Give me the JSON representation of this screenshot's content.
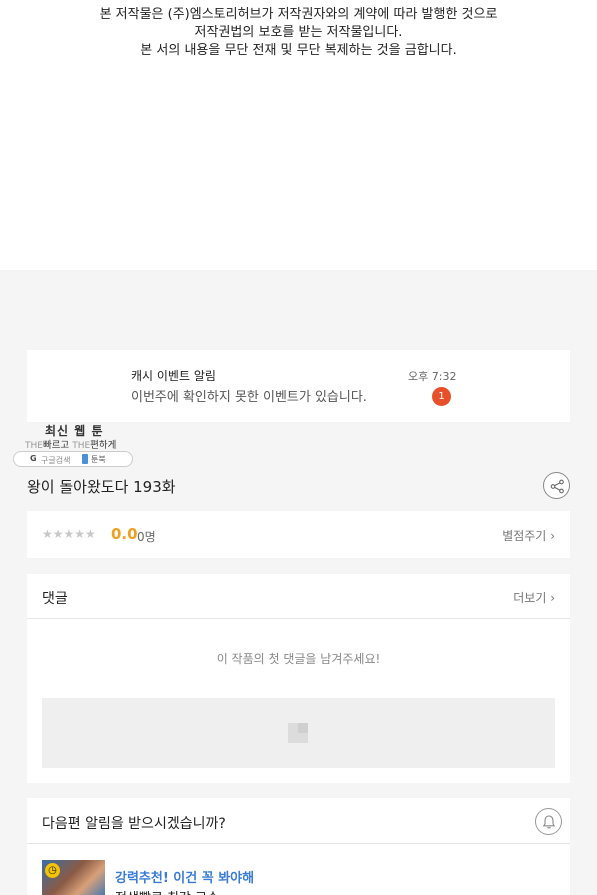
{
  "copyright": {
    "line1": "본 저작물은 (주)엠스토리허브가 저작권자와의 계약에 따라 발행한 것으로",
    "line2": "저작권법의 보호를 받는 저작물입니다.",
    "line3": "본 서의 내용을 무단 전재 및 무단 복제하는 것을 금합니다."
  },
  "notification": {
    "title": "캐시 이벤트 알림",
    "message": "이번주에 확인하지 못한 이벤트가 있습니다.",
    "time": "오후 7:32",
    "badge": "1",
    "badge_color": "#e8502b"
  },
  "logo": {
    "name": "최신 웹 툰",
    "tag_the1": "THE",
    "tag_fast": "빠르고",
    "tag_the2": "THE",
    "tag_easy": "편하게",
    "search_label": "구글검색",
    "bookmark_label": "툰북"
  },
  "episode": {
    "title": "왕이 돌아왔도다 193화",
    "share_icon": "share-icon"
  },
  "rating": {
    "stars": "★★★★★",
    "score": "0.0",
    "count": "0명",
    "rate_label": "별점주기",
    "score_color": "#f0a020"
  },
  "comments": {
    "title": "댓글",
    "more_label": "더보기",
    "empty_message": "이 작품의 첫 댓글을 남겨주세요!"
  },
  "next_episode": {
    "question": "다음편 알림을 받으시겠습니까?",
    "bell_icon": "bell-icon",
    "promo_label": "강력추천! 이건 꼭 봐야해",
    "promo_title": "전생빨로 최강 고수",
    "promo_color": "#3a7bd5"
  }
}
